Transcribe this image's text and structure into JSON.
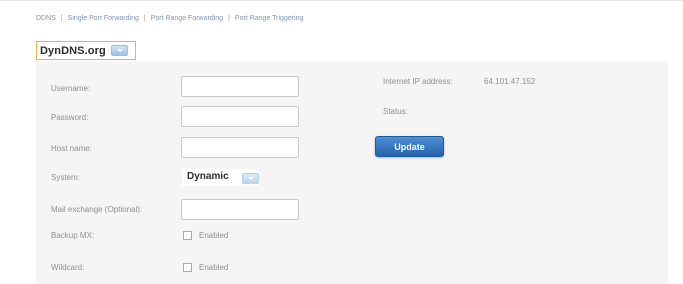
{
  "tabs": [
    {
      "label": "DDNS"
    },
    {
      "label": "Single Port Forwarding"
    },
    {
      "label": "Port Range Forwarding"
    },
    {
      "label": "Port Range Triggering"
    }
  ],
  "tab_separator": "|",
  "provider_select": {
    "value": "DynDNS.org"
  },
  "form": {
    "username_label": "Username:",
    "username_value": "",
    "password_label": "Password:",
    "password_value": "",
    "hostname_label": "Host name:",
    "hostname_value": "",
    "system_label": "System:",
    "system_value": "Dynamic",
    "mx_label": "Mail exchange (Optional):",
    "mx_value": "",
    "backup_mx_label": "Backup MX:",
    "backup_mx_checkbox_label": "Enabled",
    "backup_mx_checked": false,
    "wildcard_label": "Wildcard:",
    "wildcard_checkbox_label": "Enabled",
    "wildcard_checked": false
  },
  "status_panel": {
    "ip_label": "Internet IP address:",
    "ip_value": "64.101.47.152",
    "status_label": "Status:",
    "status_value": "",
    "update_label": "Update"
  },
  "colors": {
    "accent_blue": "#2c6ab3",
    "select_border": "#f0b43c",
    "panel_bg": "#f5f5f5"
  }
}
